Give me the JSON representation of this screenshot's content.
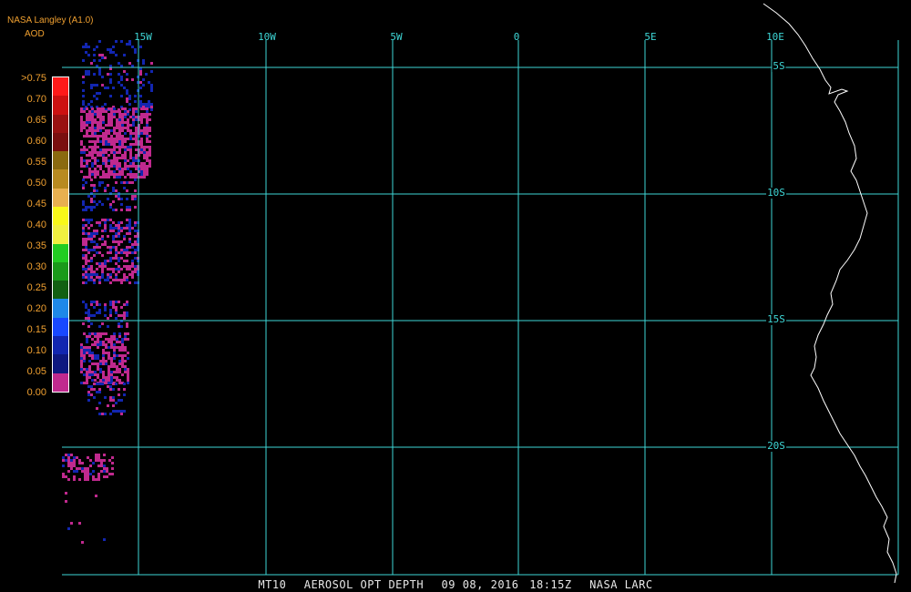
{
  "header": {
    "source_line": "NASA Langley (A1.0)",
    "variable_line": "AOD"
  },
  "longitude_labels": [
    "15W",
    "10W",
    "5W",
    "0",
    "5E",
    "10E"
  ],
  "latitude_labels": [
    "5S",
    "10S",
    "15S",
    "20S"
  ],
  "legend": {
    "ticks": [
      ">0.75",
      "0.70",
      "0.65",
      "0.60",
      "0.55",
      "0.50",
      "0.45",
      "0.40",
      "0.35",
      "0.30",
      "0.25",
      "0.20",
      "0.15",
      "0.10",
      "0.05",
      "0.00"
    ],
    "colors": [
      "#ff1a1a",
      "#cc1111",
      "#991111",
      "#7a0f0f",
      "#8a6a10",
      "#b88a20",
      "#e8b050",
      "#f8f81a",
      "#f0f040",
      "#22cc22",
      "#1a9a1a",
      "#126012",
      "#1e88e8",
      "#1848ff",
      "#1226b0",
      "#0e1880",
      "#c0298e"
    ]
  },
  "footer": {
    "product": "MT10",
    "parameter": "AEROSOL OPT DEPTH",
    "date": "09 08, 2016",
    "time": "18:15Z",
    "agency": "NASA LARC"
  },
  "colors": {
    "grid": "#3ed6d6",
    "coast": "#ffffff",
    "aod_high": "#c0298e",
    "aod_low": "#1226b0",
    "label": "#f0a030"
  }
}
